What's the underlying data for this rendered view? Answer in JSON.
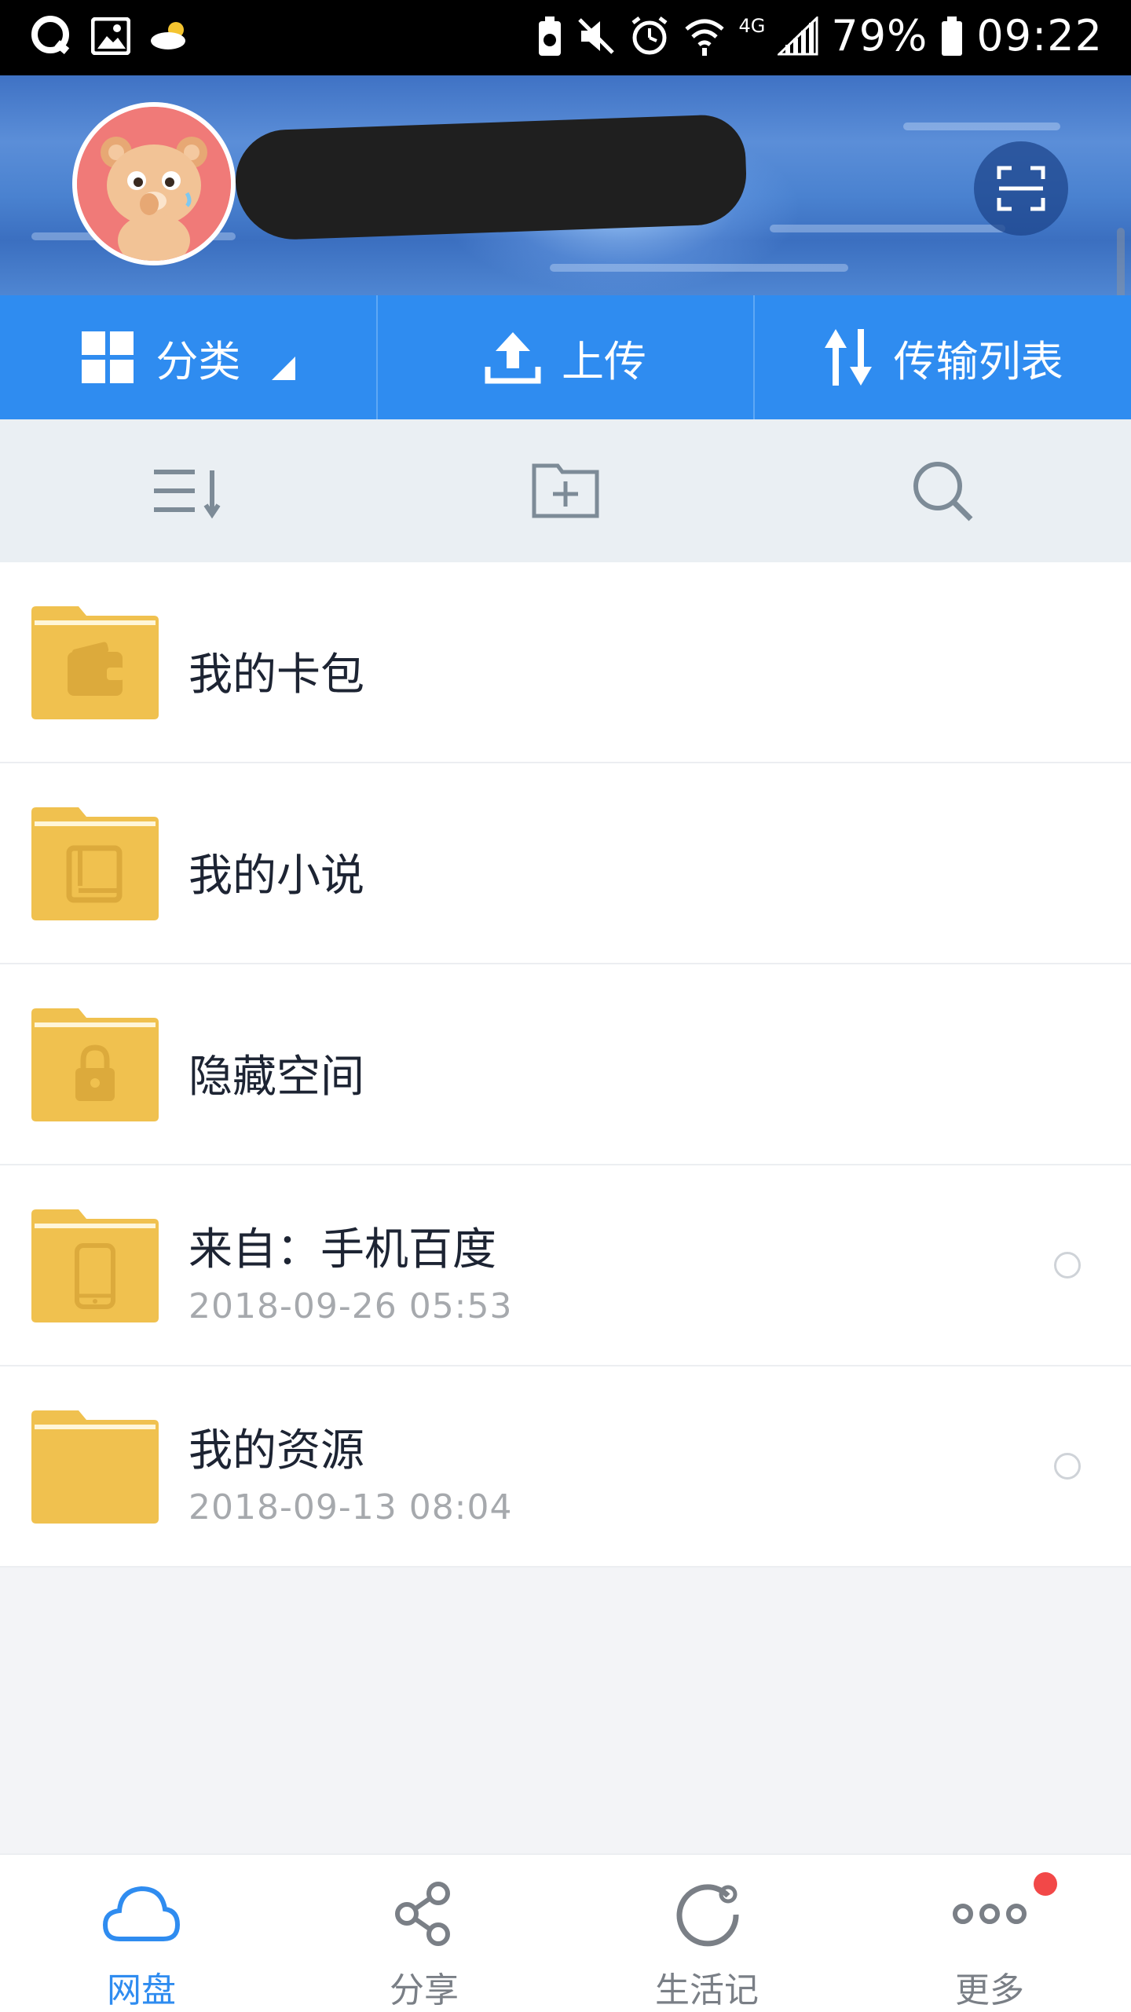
{
  "status_bar": {
    "battery_percent": "79%",
    "time": "09:22",
    "network": "4G"
  },
  "header": {
    "avatar_icon": "bear-avatar-icon",
    "scan_icon": "scan-icon"
  },
  "action_bar": {
    "items": [
      {
        "label": "分类",
        "icon": "grid-icon"
      },
      {
        "label": "上传",
        "icon": "upload-icon"
      },
      {
        "label": "传输列表",
        "icon": "transfer-icon"
      }
    ]
  },
  "toolbar": {
    "icons": [
      "sort-icon",
      "new-folder-icon",
      "search-icon"
    ]
  },
  "files": [
    {
      "name": "我的卡包",
      "date": "",
      "icon": "wallet-icon"
    },
    {
      "name": "我的小说",
      "date": "",
      "icon": "book-icon"
    },
    {
      "name": "隐藏空间",
      "date": "",
      "icon": "lock-icon"
    },
    {
      "name": "来自：手机百度",
      "date": "2018-09-26  05:53",
      "icon": "phone-icon"
    },
    {
      "name": "我的资源",
      "date": "2018-09-13  08:04",
      "icon": ""
    }
  ],
  "bottom_nav": {
    "items": [
      {
        "label": "网盘",
        "icon": "cloud-icon"
      },
      {
        "label": "分享",
        "icon": "share-icon"
      },
      {
        "label": "生活记",
        "icon": "life-icon"
      },
      {
        "label": "更多",
        "icon": "more-icon"
      }
    ]
  },
  "colors": {
    "accent": "#2f8cf0",
    "folder": "#f2c44f",
    "background": "#f3f4f7"
  }
}
